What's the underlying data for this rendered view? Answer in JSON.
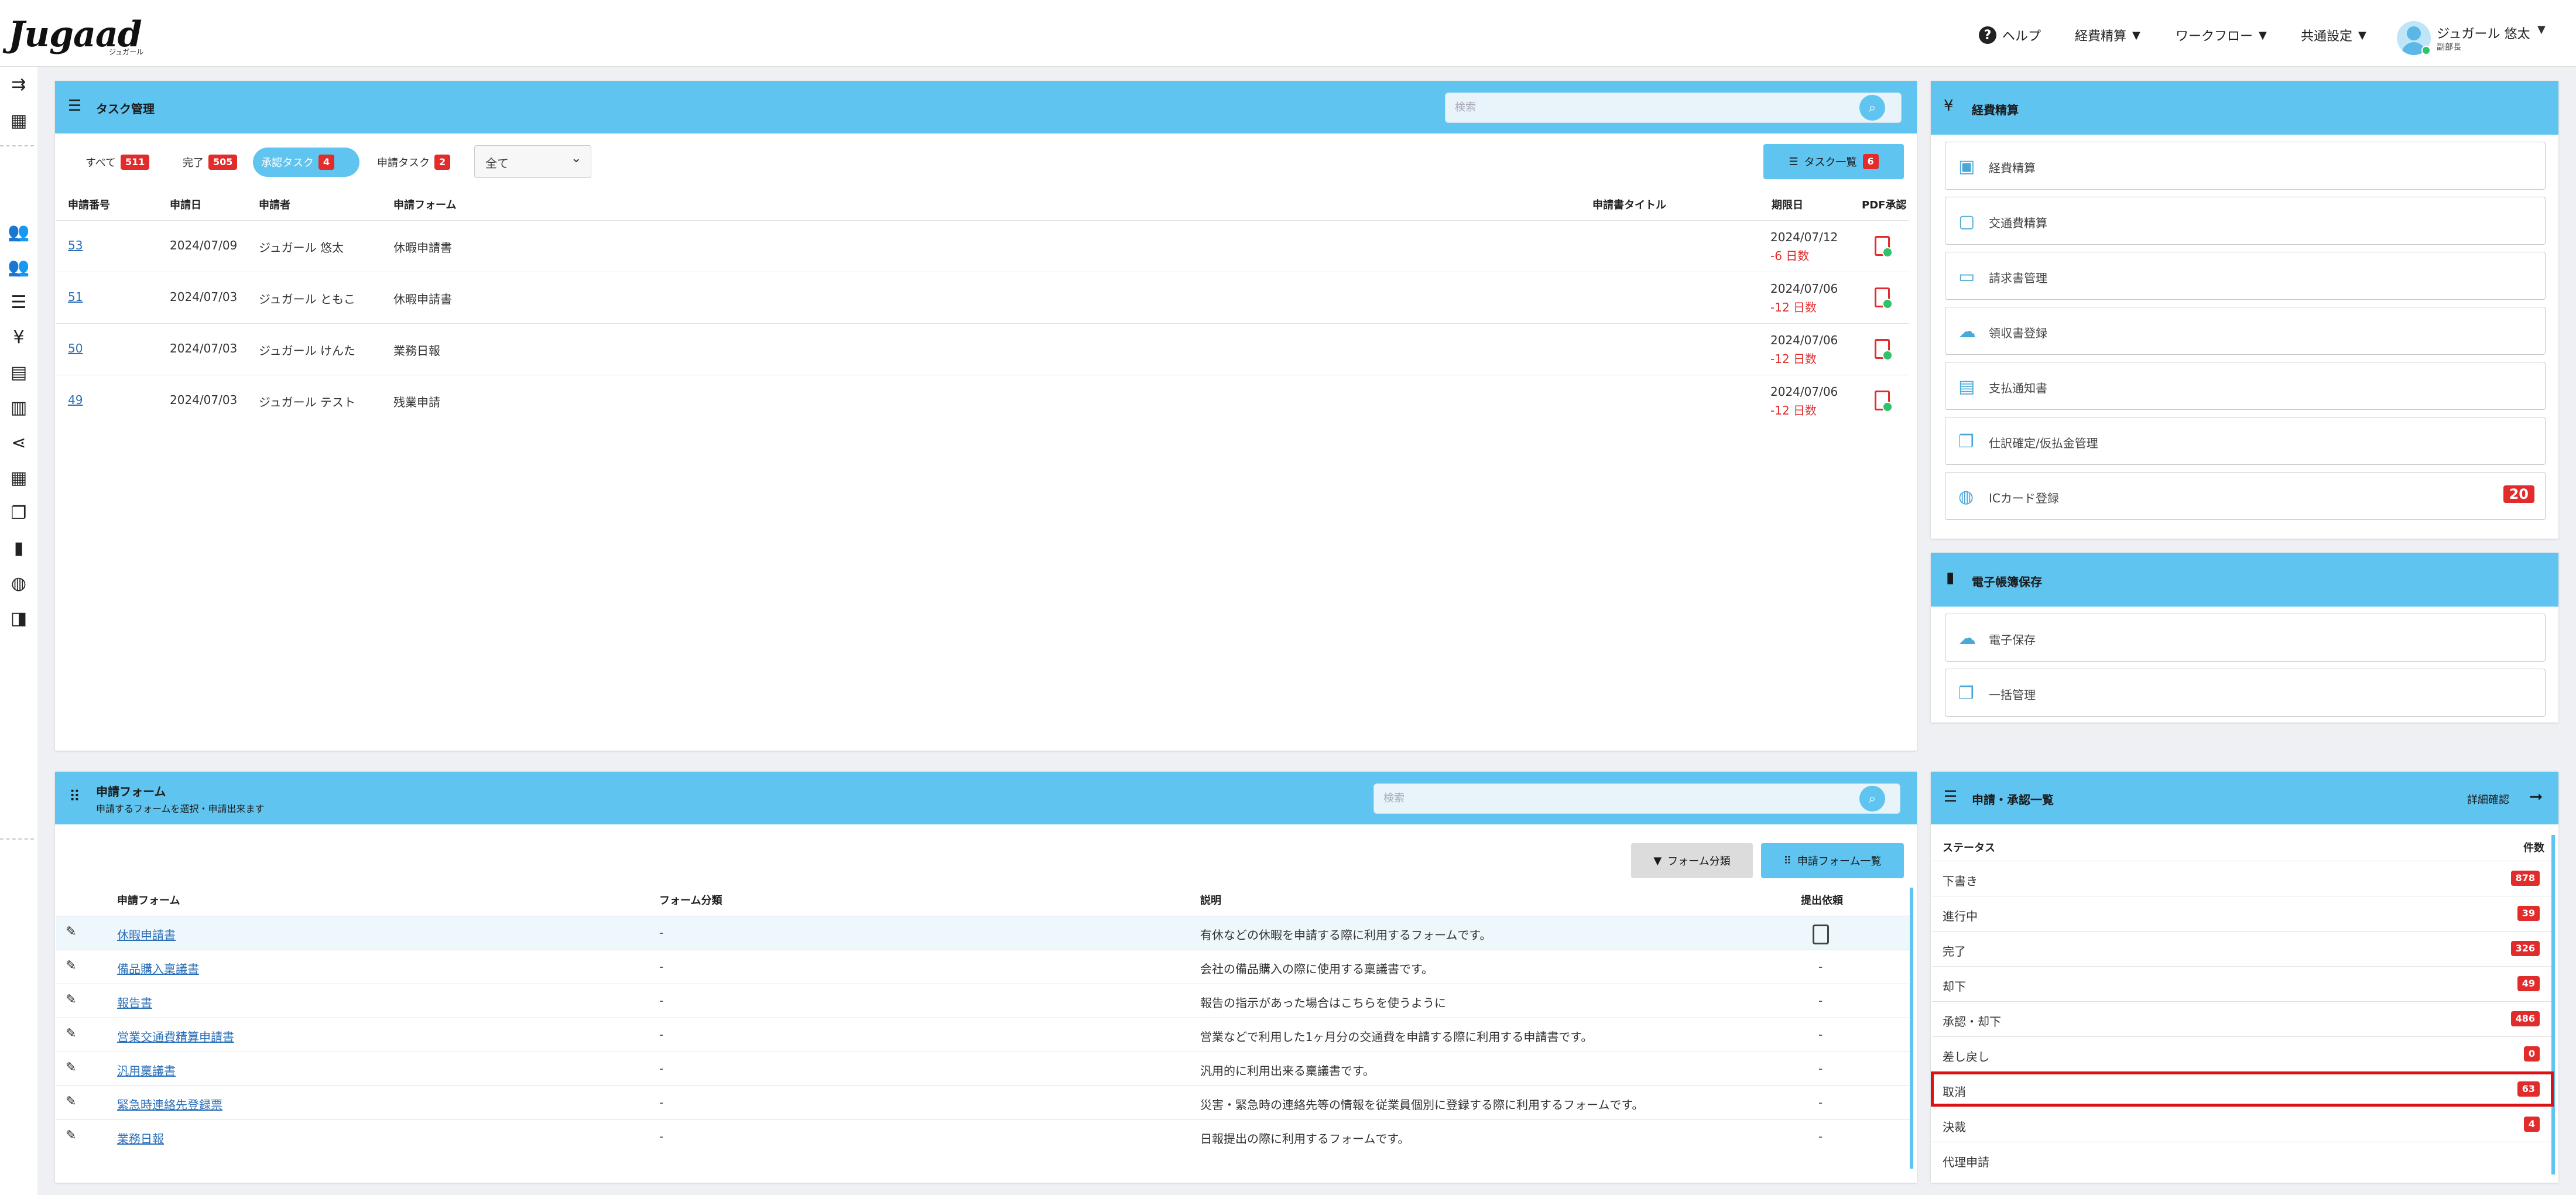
{
  "header": {
    "logo": "Jugaad",
    "logo_sub": "ジュガール",
    "help": "ヘルプ",
    "nav": [
      "経費精算",
      "ワークフロー",
      "共通設定"
    ],
    "user_name": "ジュガール 悠太",
    "user_role": "副部長"
  },
  "sidebar_icons": [
    "menu-toggle-icon",
    "building-icon",
    "users-icon",
    "users-alt-icon",
    "list-icon",
    "yen-icon",
    "document-icon",
    "document-stack-icon",
    "share-icon",
    "table-icon",
    "copy-icon",
    "file-icon",
    "globe-icon",
    "wallet-icon"
  ],
  "task_panel": {
    "title": "タスク管理",
    "search_placeholder": "検索",
    "tabs": [
      {
        "label": "すべて",
        "count": "511"
      },
      {
        "label": "完了",
        "count": "505"
      },
      {
        "label": "承認タスク",
        "count": "4"
      },
      {
        "label": "申請タスク",
        "count": "2"
      }
    ],
    "filter_value": "全て",
    "list_button": "タスク一覧",
    "list_button_count": "6",
    "columns": [
      "申請番号",
      "申請日",
      "申請者",
      "申請フォーム",
      "申請書タイトル",
      "期限日",
      "PDF承認"
    ],
    "rows": [
      {
        "no": "53",
        "date": "2024/07/09",
        "applicant": "ジュガール 悠太",
        "form": "休暇申請書",
        "title": "",
        "due": "2024/07/12",
        "days": "-6 日数"
      },
      {
        "no": "51",
        "date": "2024/07/03",
        "applicant": "ジュガール ともこ",
        "form": "休暇申請書",
        "title": "",
        "due": "2024/07/06",
        "days": "-12 日数"
      },
      {
        "no": "50",
        "date": "2024/07/03",
        "applicant": "ジュガール けんた",
        "form": "業務日報",
        "title": "",
        "due": "2024/07/06",
        "days": "-12 日数"
      },
      {
        "no": "49",
        "date": "2024/07/03",
        "applicant": "ジュガール テスト",
        "form": "残業申請",
        "title": "",
        "due": "2024/07/06",
        "days": "-12 日数"
      }
    ]
  },
  "expense_panel": {
    "title": "経費精算",
    "items": [
      {
        "label": "経費精算",
        "icon": "receipt-icon",
        "badge": ""
      },
      {
        "label": "交通費精算",
        "icon": "train-icon",
        "badge": ""
      },
      {
        "label": "請求書管理",
        "icon": "card-icon",
        "badge": ""
      },
      {
        "label": "領収書登録",
        "icon": "cloud-upload-icon",
        "badge": ""
      },
      {
        "label": "支払通知書",
        "icon": "notice-icon",
        "badge": ""
      },
      {
        "label": "仕訳確定/仮払金管理",
        "icon": "copy-icon",
        "badge": ""
      },
      {
        "label": "ICカード登録",
        "icon": "globe-icon",
        "badge": "20"
      }
    ]
  },
  "ebook_panel": {
    "title": "電子帳簿保存",
    "items": [
      {
        "label": "電子保存",
        "icon": "cloud-upload-icon"
      },
      {
        "label": "一括管理",
        "icon": "copy-icon"
      }
    ]
  },
  "form_panel": {
    "title": "申請フォーム",
    "subtitle": "申請するフォームを選択・申請出来ます",
    "search_placeholder": "検索",
    "category_button": "フォーム分類",
    "list_button": "申請フォーム一覧",
    "columns": [
      "申請フォーム",
      "フォーム分類",
      "説明",
      "提出依頼"
    ],
    "rows": [
      {
        "name": "休暇申請書",
        "category": "-",
        "desc": "有休などの休暇を申請する際に利用するフォームです。",
        "submit": ""
      },
      {
        "name": "備品購入稟議書",
        "category": "-",
        "desc": "会社の備品購入の際に使用する稟議書です。",
        "submit": "-"
      },
      {
        "name": "報告書",
        "category": "-",
        "desc": "報告の指示があった場合はこちらを使うように",
        "submit": "-"
      },
      {
        "name": "営業交通費精算申請書",
        "category": "-",
        "desc": "営業などで利用した1ヶ月分の交通費を申請する際に利用する申請書です。",
        "submit": "-"
      },
      {
        "name": "汎用稟議書",
        "category": "-",
        "desc": "汎用的に利用出来る稟議書です。",
        "submit": "-"
      },
      {
        "name": "緊急時連絡先登録票",
        "category": "-",
        "desc": "災害・緊急時の連絡先等の情報を従業員個別に登録する際に利用するフォームです。",
        "submit": "-"
      },
      {
        "name": "業務日報",
        "category": "-",
        "desc": "日報提出の際に利用するフォームです。",
        "submit": "-"
      }
    ]
  },
  "status_panel": {
    "title": "申請・承認一覧",
    "detail_link": "詳細確認",
    "col_status": "ステータス",
    "col_count": "件数",
    "rows": [
      {
        "name": "下書き",
        "count": "878"
      },
      {
        "name": "進行中",
        "count": "39"
      },
      {
        "name": "完了",
        "count": "326"
      },
      {
        "name": "却下",
        "count": "49"
      },
      {
        "name": "承認・却下",
        "count": "486"
      },
      {
        "name": "差し戻し",
        "count": "0"
      },
      {
        "name": "取消",
        "count": "63"
      },
      {
        "name": "決裁",
        "count": "4"
      },
      {
        "name": "代理申請",
        "count": ""
      }
    ]
  }
}
